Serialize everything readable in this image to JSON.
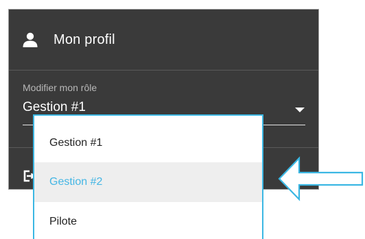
{
  "profile": {
    "label": "Mon profil",
    "icon": "user-icon"
  },
  "role_select": {
    "caption": "Modifier mon rôle",
    "value": "Gestion #1",
    "icon": "dropdown-arrow-icon"
  },
  "dropdown": {
    "options": [
      {
        "label": "Gestion #1",
        "highlighted": false
      },
      {
        "label": "Gestion #2",
        "highlighted": true
      },
      {
        "label": "Pilote",
        "highlighted": false
      }
    ]
  },
  "logout": {
    "icon": "logout-icon"
  },
  "annotation": {
    "icon": "callout-arrow-icon"
  },
  "colors": {
    "panel_background": "#3a3a3a",
    "accent": "#3bb7e3",
    "highlight_text": "#44b6e4",
    "highlight_background": "#eeeeee"
  }
}
